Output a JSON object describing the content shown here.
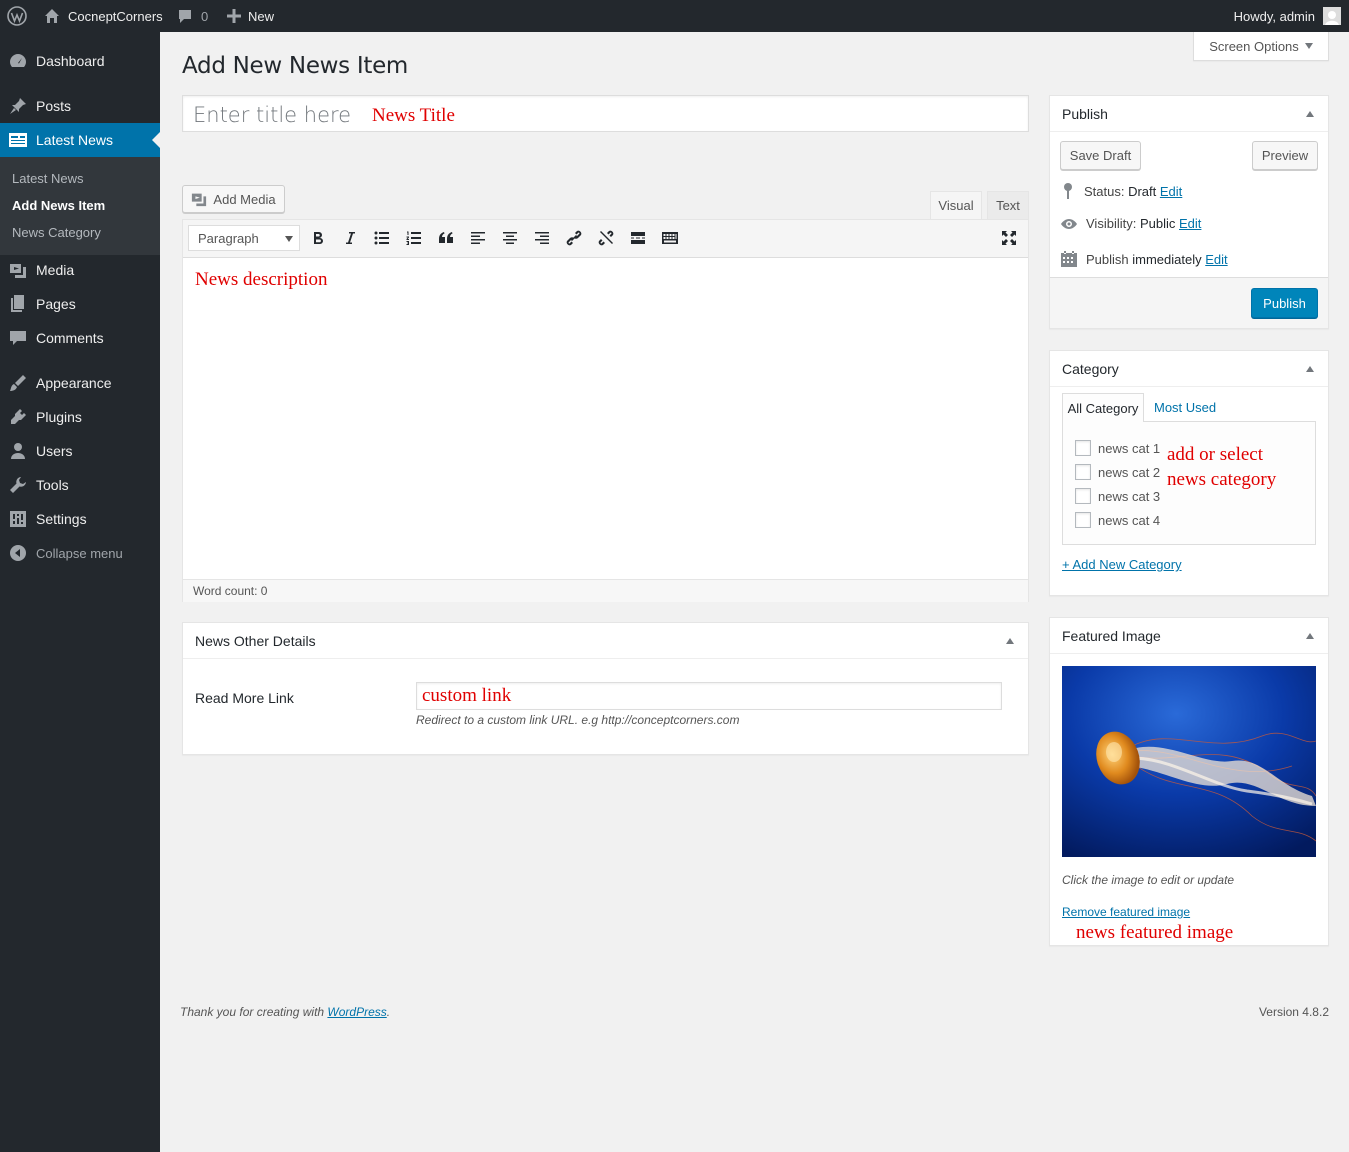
{
  "adminbar": {
    "site_name": "CocneptCorners",
    "comments_count": "0",
    "new_label": "New",
    "howdy": "Howdy, admin"
  },
  "sidebar": {
    "dashboard": "Dashboard",
    "posts": "Posts",
    "latest_news": "Latest News",
    "submenu": [
      "Latest News",
      "Add News Item",
      "News Category"
    ],
    "media": "Media",
    "pages": "Pages",
    "comments": "Comments",
    "appearance": "Appearance",
    "plugins": "Plugins",
    "users": "Users",
    "tools": "Tools",
    "settings": "Settings",
    "collapse": "Collapse menu"
  },
  "screen_options": "Screen Options",
  "page_title": "Add New News Item",
  "title_field": {
    "placeholder": "Enter title here",
    "annotation": "News Title"
  },
  "editor": {
    "add_media": "Add Media",
    "tab_visual": "Visual",
    "tab_text": "Text",
    "format_select": "Paragraph",
    "annotation": "News description",
    "word_count": "Word count: 0"
  },
  "other_details": {
    "title": "News Other Details",
    "read_more_label": "Read More Link",
    "input_annotation": "custom link",
    "description": "Redirect to a custom link URL. e.g http://conceptcorners.com"
  },
  "publish": {
    "title": "Publish",
    "save_draft": "Save Draft",
    "preview": "Preview",
    "status_label": "Status:",
    "status_value": "Draft",
    "visibility_label": "Visibility:",
    "visibility_value": "Public",
    "publish_label": "Publish",
    "publish_value": "immediately",
    "edit": "Edit",
    "publish_button": "Publish"
  },
  "category": {
    "title": "Category",
    "tab_all": "All Category",
    "tab_most_used": "Most Used",
    "items": [
      "news cat 1",
      "news cat 2",
      "news cat 3",
      "news cat 4"
    ],
    "annotation_line1": "add or select",
    "annotation_line2": "news category",
    "add_new": "+ Add New Category"
  },
  "featured_image": {
    "title": "Featured Image",
    "hint": "Click the image to edit or update",
    "remove": "Remove featured image",
    "annotation": "news featured image"
  },
  "footer": {
    "thanks_prefix": "Thank you for creating with ",
    "wordpress": "WordPress",
    "thanks_suffix": ".",
    "version": "Version 4.8.2"
  },
  "colors": {
    "admin_bar": "#23282d",
    "accent": "#0073aa",
    "annotation_red": "#e00000"
  }
}
